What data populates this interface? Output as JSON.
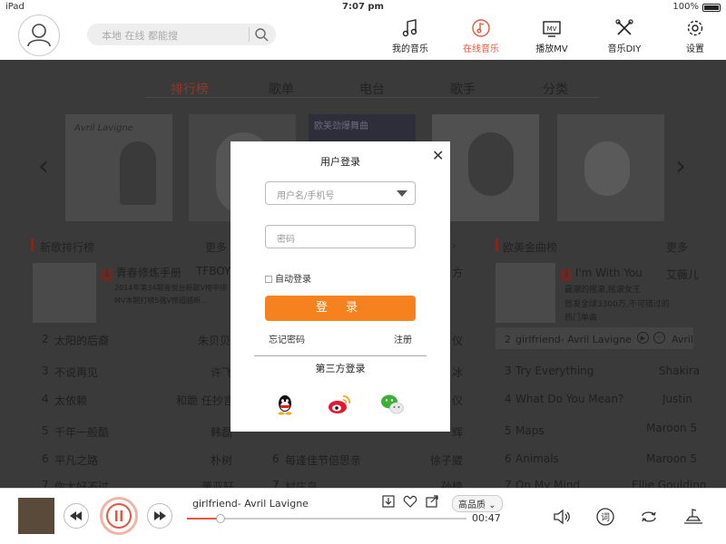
{
  "status_bar": {
    "device": "iPad",
    "time": "7:07 pm",
    "battery": "100%"
  },
  "header": {
    "search_placeholder": "本地  在线  都能搜",
    "nav": [
      {
        "label": "我的音乐",
        "icon": "music-note-icon",
        "active": false
      },
      {
        "label": "在线音乐",
        "icon": "music-circle-icon",
        "active": true
      },
      {
        "label": "播放MV",
        "icon": "mv-icon",
        "active": false
      },
      {
        "label": "音乐DIY",
        "icon": "tools-icon",
        "active": false
      },
      {
        "label": "设置",
        "icon": "gear-icon",
        "active": false
      }
    ]
  },
  "categories": [
    "排行榜",
    "歌单",
    "电台",
    "歌手",
    "分类"
  ],
  "covers_text": {
    "cover1": "Avril Lavigne",
    "cover3": "欧美劲爆舞曲"
  },
  "chart_left": {
    "title": "新歌排行榜",
    "more": "更多",
    "top": {
      "rank": "1",
      "title": "青春修炼手册",
      "artist": "TFBOYS",
      "desc1": "2014年第34期音悦台新歌V榜中排",
      "desc2": "MV本期打榜5强V榜超越新..."
    },
    "rows": [
      {
        "rank": "2",
        "title": "太阳的后裔",
        "artist": "朱贝贝"
      },
      {
        "rank": "3",
        "title": "不说再见",
        "artist": "许飞"
      },
      {
        "rank": "4",
        "title": "太依赖",
        "artist": "和跪 任抄言"
      },
      {
        "rank": "5",
        "title": "千年一般酷",
        "artist": "韩磊"
      },
      {
        "rank": "6",
        "title": "平凡之路",
        "artist": "朴树"
      },
      {
        "rank": "7",
        "title": "你太好不过",
        "artist": "萧亚轩"
      }
    ]
  },
  "chart_mid": {
    "more": "更多",
    "partials": [
      "方",
      "仪",
      "冰",
      "仪",
      "辉"
    ],
    "row6": {
      "rank": "6",
      "title": "每逢佳节倍思亲",
      "artist": "徐子崴"
    },
    "row7": {
      "rank": "7",
      "title": "村庄鸟",
      "artist": "孙楠"
    }
  },
  "chart_right": {
    "title": "欧美金曲榜",
    "more": "更多",
    "top": {
      "rank": "1",
      "title": "I'm With You",
      "artist": "艾薇儿",
      "desc1": "最潮的摇滚,摇滚女王",
      "desc2": "首发全球3300万,不可错过的",
      "desc3": "热门单曲"
    },
    "rows": [
      {
        "rank": "2",
        "title": "girlfriend- Avril  Lavigne",
        "artist": "Avril"
      },
      {
        "rank": "3",
        "title": "Try Everything",
        "artist": "Shakira"
      },
      {
        "rank": "4",
        "title": "What Do You Mean?",
        "artist": "Justin"
      },
      {
        "rank": "5",
        "title": "Maps",
        "artist": "Maroon 5"
      },
      {
        "rank": "6",
        "title": "Animals",
        "artist": "Maroon 5"
      },
      {
        "rank": "7",
        "title": "On My Mind",
        "artist": "Ellie Goulding"
      }
    ]
  },
  "player": {
    "track": "girlfriend- Avril   Lavigne",
    "time": "00:47",
    "quality": "高品质",
    "progress_pct": 12
  },
  "modal": {
    "title": "用户登录",
    "username_placeholder": "用户名/手机号",
    "password_placeholder": "密码",
    "auto_login": "自动登录",
    "login_button": "登  录",
    "forgot": "忘记密码",
    "register": "注册",
    "third_party": "第三方登录"
  },
  "colors": {
    "accent": "#e8543e",
    "login_button": "#f5821f",
    "overlay": "#3a3a3a"
  }
}
